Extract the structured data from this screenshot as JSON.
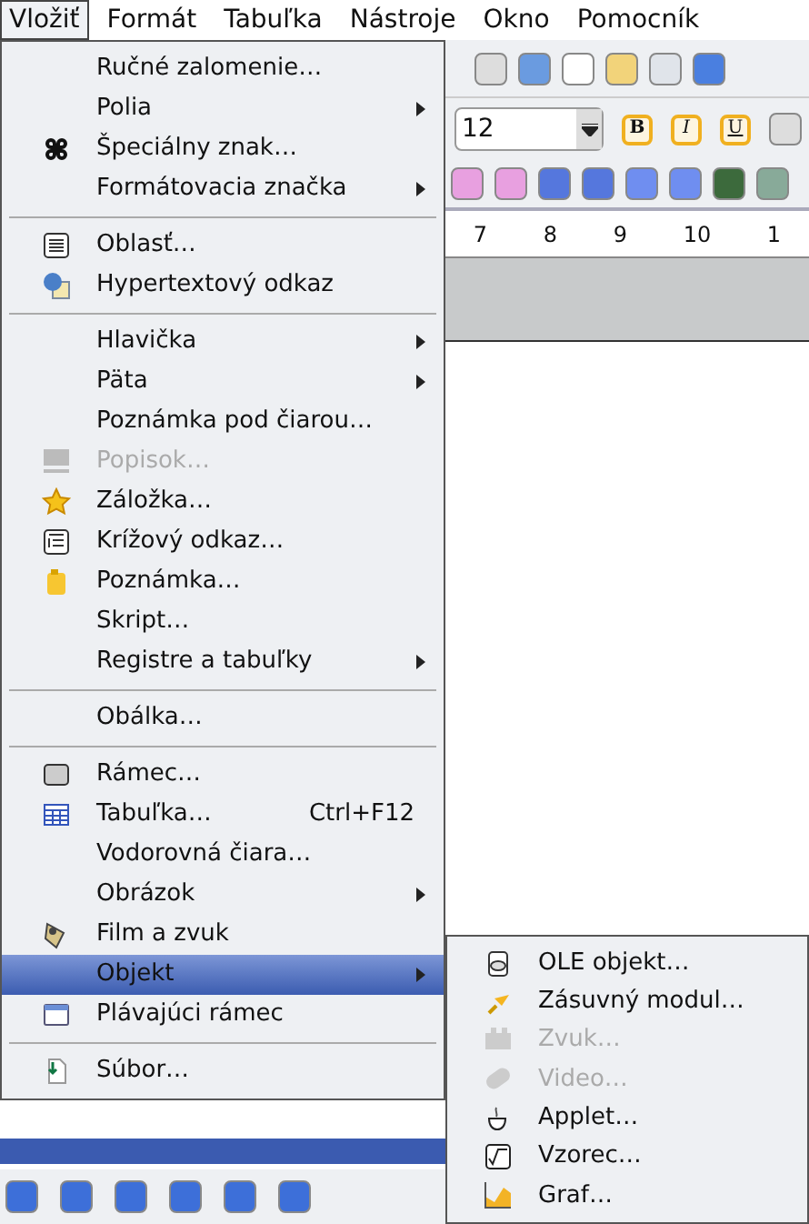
{
  "menubar": [
    {
      "label": "Vložiť",
      "selected": true
    },
    {
      "label": "Formát",
      "selected": false
    },
    {
      "label": "Tabuľka",
      "selected": false
    },
    {
      "label": "Nástroje",
      "selected": false
    },
    {
      "label": "Okno",
      "selected": false
    },
    {
      "label": "Pomocník",
      "selected": false
    }
  ],
  "font_size_field": {
    "value": "12"
  },
  "format_buttons": [
    "B",
    "I",
    "U"
  ],
  "ruler": [
    "7",
    "8",
    "9",
    "10",
    "1"
  ],
  "menu": [
    {
      "kind": "item",
      "label": "Ručné zalomenie…",
      "selected": false
    },
    {
      "kind": "item",
      "label": "Polia",
      "submenu": true,
      "selected": false
    },
    {
      "kind": "item",
      "label": "Špeciálny znak…",
      "selected": false
    },
    {
      "kind": "item",
      "label": "Formátovacia značka",
      "submenu": true,
      "selected": false
    },
    {
      "kind": "separator"
    },
    {
      "kind": "item",
      "label": "Oblasť…",
      "selected": false
    },
    {
      "kind": "item",
      "label": "Hypertextový odkaz",
      "selected": false
    },
    {
      "kind": "separator"
    },
    {
      "kind": "item",
      "label": "Hlavička",
      "submenu": true,
      "selected": false
    },
    {
      "kind": "item",
      "label": "Päta",
      "submenu": true,
      "selected": false
    },
    {
      "kind": "item",
      "label": "Poznámka pod čiarou…",
      "selected": false
    },
    {
      "kind": "item",
      "label": "Popisok…",
      "disabled": true,
      "selected": false
    },
    {
      "kind": "item",
      "label": "Záložka…",
      "selected": false
    },
    {
      "kind": "item",
      "label": "Krížový odkaz…",
      "selected": false
    },
    {
      "kind": "item",
      "label": "Poznámka…",
      "selected": false
    },
    {
      "kind": "item",
      "label": "Skript…",
      "selected": false
    },
    {
      "kind": "item",
      "label": "Registre a tabuľky",
      "submenu": true,
      "selected": false
    },
    {
      "kind": "separator"
    },
    {
      "kind": "item",
      "label": "Obálka…",
      "selected": false
    },
    {
      "kind": "separator"
    },
    {
      "kind": "item",
      "label": "Rámec…",
      "selected": false
    },
    {
      "kind": "item",
      "label": "Tabuľka…",
      "shortcut": "Ctrl+F12",
      "selected": false
    },
    {
      "kind": "item",
      "label": "Vodorovná čiara…",
      "selected": false
    },
    {
      "kind": "item",
      "label": "Obrázok",
      "submenu": true,
      "selected": false
    },
    {
      "kind": "item",
      "label": "Film a zvuk",
      "selected": false
    },
    {
      "kind": "item",
      "label": "Objekt",
      "submenu": true,
      "selected": true
    },
    {
      "kind": "item",
      "label": "Plávajúci rámec",
      "selected": false
    },
    {
      "kind": "separator"
    },
    {
      "kind": "item",
      "label": "Súbor…",
      "selected": false
    }
  ],
  "submenu": [
    {
      "label": "OLE objekt…",
      "disabled": false
    },
    {
      "label": "Zásuvný modul…",
      "disabled": false
    },
    {
      "label": "Zvuk…",
      "disabled": true
    },
    {
      "label": "Video…",
      "disabled": true
    },
    {
      "label": "Applet…",
      "disabled": false
    },
    {
      "label": "Vzorec…",
      "disabled": false
    },
    {
      "label": "Graf…",
      "disabled": false
    }
  ]
}
